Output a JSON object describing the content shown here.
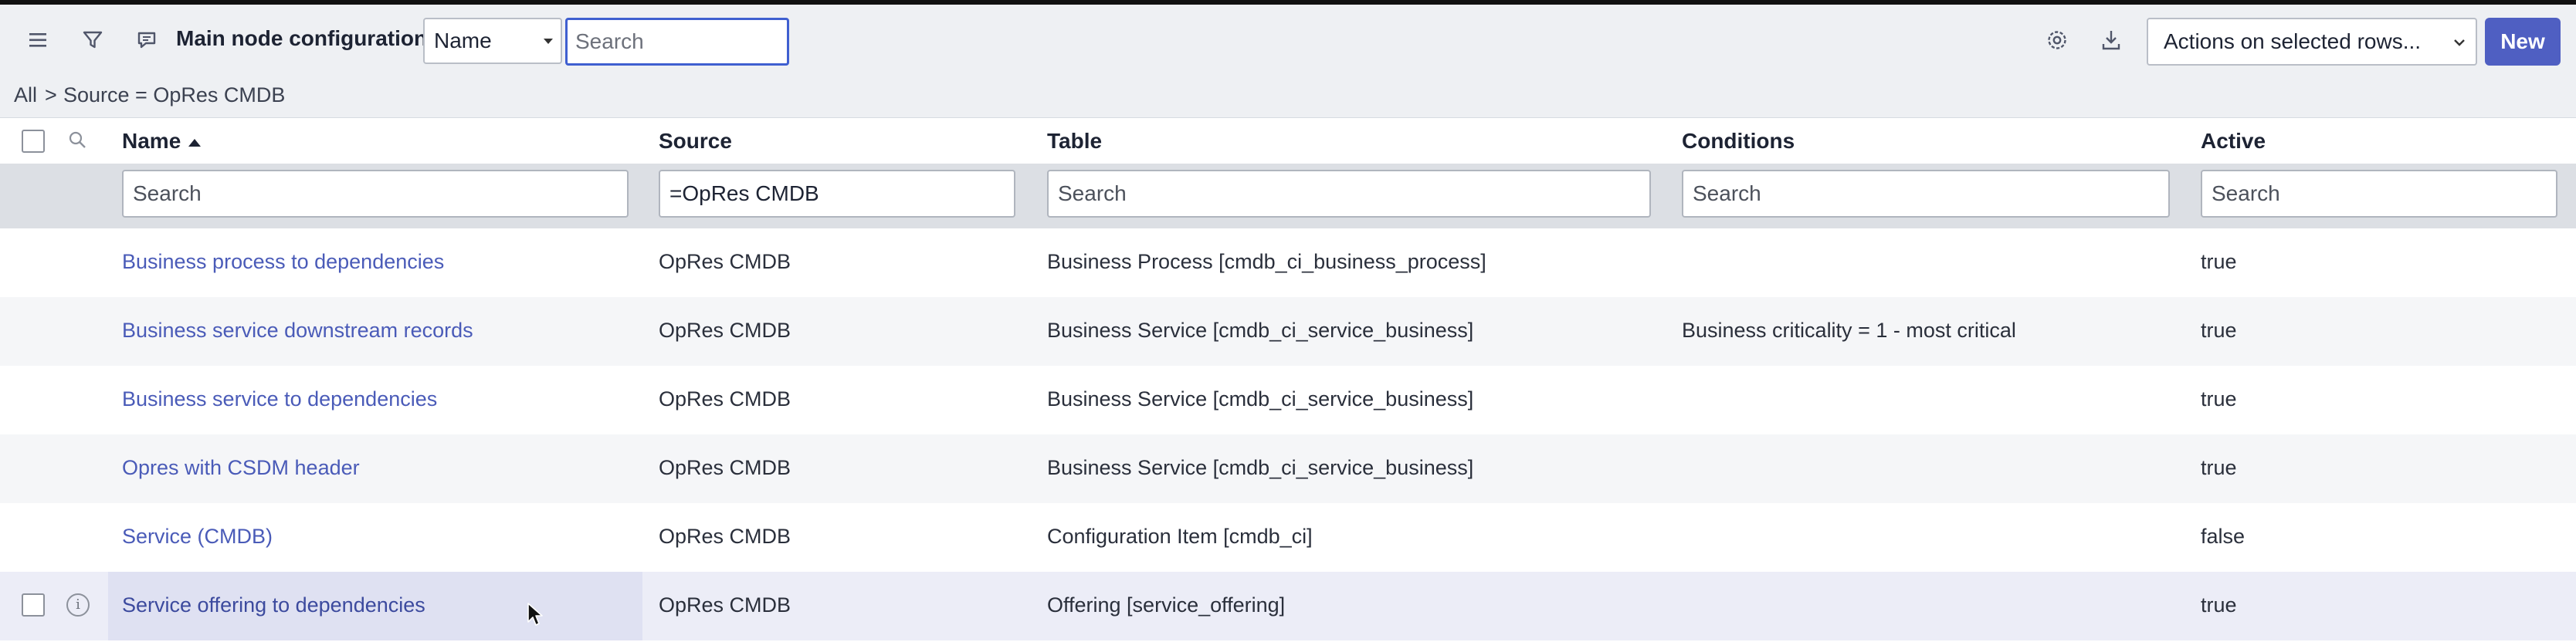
{
  "header": {
    "title": "Main node configurations",
    "field_select_value": "Name",
    "search_placeholder": "Search",
    "actions_label": "Actions on selected rows...",
    "new_label": "New"
  },
  "breadcrumb": {
    "all": "All",
    "separator": ">",
    "condition": "Source = OpRes CMDB"
  },
  "columns": {
    "name": "Name",
    "source": "Source",
    "table": "Table",
    "conditions": "Conditions",
    "active": "Active"
  },
  "filters": {
    "name": "",
    "source": "=OpRes CMDB",
    "table": "",
    "conditions": "",
    "active": "",
    "placeholder": "Search"
  },
  "rows": [
    {
      "name": "Business process to dependencies",
      "source": "OpRes CMDB",
      "table": "Business Process [cmdb_ci_business_process]",
      "conditions": "",
      "active": "true"
    },
    {
      "name": "Business service downstream records",
      "source": "OpRes CMDB",
      "table": "Business Service [cmdb_ci_service_business]",
      "conditions": "Business criticality = 1 - most critical",
      "active": "true"
    },
    {
      "name": "Business service to dependencies",
      "source": "OpRes CMDB",
      "table": "Business Service [cmdb_ci_service_business]",
      "conditions": "",
      "active": "true"
    },
    {
      "name": "Opres with CSDM header",
      "source": "OpRes CMDB",
      "table": "Business Service [cmdb_ci_service_business]",
      "conditions": "",
      "active": "true"
    },
    {
      "name": "Service (CMDB)",
      "source": "OpRes CMDB",
      "table": "Configuration Item [cmdb_ci]",
      "conditions": "",
      "active": "false"
    },
    {
      "name": "Service offering to dependencies",
      "source": "OpRes CMDB",
      "table": "Offering [service_offering]",
      "conditions": "",
      "active": "true"
    }
  ],
  "icons": {
    "menu": "hamburger-menu-icon",
    "filter": "filter-funnel-icon",
    "comment": "comment-icon",
    "settings": "gear-icon",
    "export": "download-icon",
    "column_search": "search-icon",
    "row_info": "info-icon"
  },
  "colors": {
    "accent": "#4f5fc2",
    "link": "#4a5bb8",
    "header_bg": "#eef0f3"
  }
}
